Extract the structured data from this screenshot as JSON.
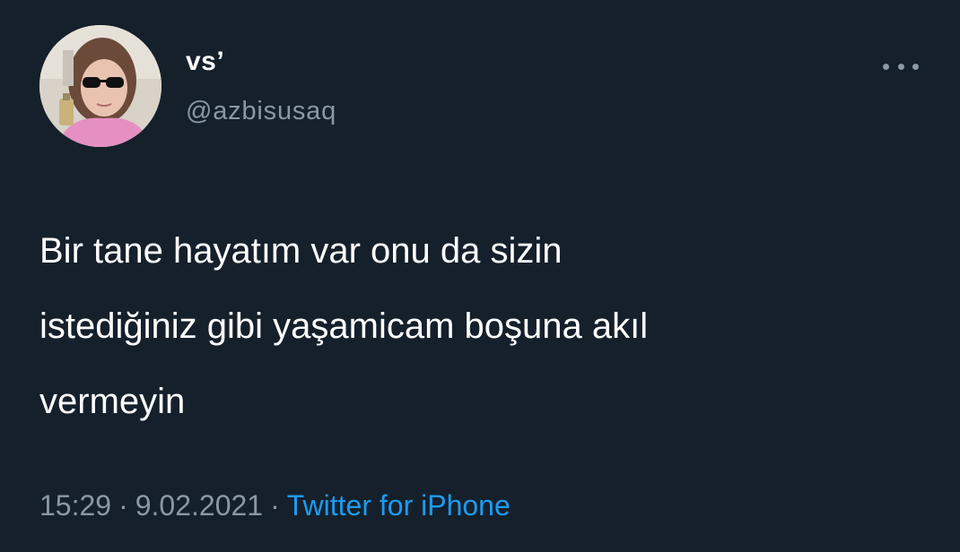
{
  "tweet": {
    "author": {
      "display_name": "vs’",
      "handle": "@azbisusaq",
      "avatar_icon": "profile-photo"
    },
    "more_icon": "more-horizontal-icon",
    "text": "Bir tane  hayatım var onu da sizin\nistediğiniz gibi yaşamicam boşuna akıl\nvermeyin",
    "time": "15:29",
    "separator": "·",
    "date": "9.02.2021",
    "source": "Twitter for iPhone"
  },
  "colors": {
    "background": "#15202b",
    "primary_text": "#ffffff",
    "secondary_text": "#8b98a5",
    "link": "#1d9bf0"
  }
}
